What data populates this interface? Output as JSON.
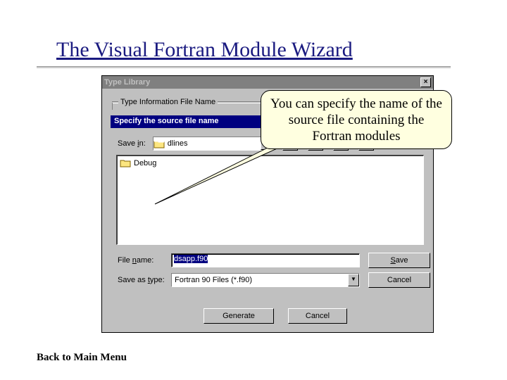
{
  "slide": {
    "title": "The Visual Fortran Module Wizard",
    "back_link": "Back to Main Menu"
  },
  "dialog": {
    "title": "Type Library",
    "group1_label": "Type Information File Name",
    "subtitle": "Specify the source file name",
    "save_in_label": "Save in:",
    "save_in_value": "dlines",
    "list_items": [
      "Debug"
    ],
    "file_name_label": "File name:",
    "file_name_value": "dsapp.f90",
    "save_as_type_label": "Save as type:",
    "save_as_type_value": "Fortran 90 Files (*.f90)",
    "btn_save": "Save",
    "btn_cancel": "Cancel",
    "btn_generate": "Generate",
    "btn_cancel2": "Cancel"
  },
  "callout": {
    "text": "You can specify the name of the source file containing the Fortran modules"
  }
}
